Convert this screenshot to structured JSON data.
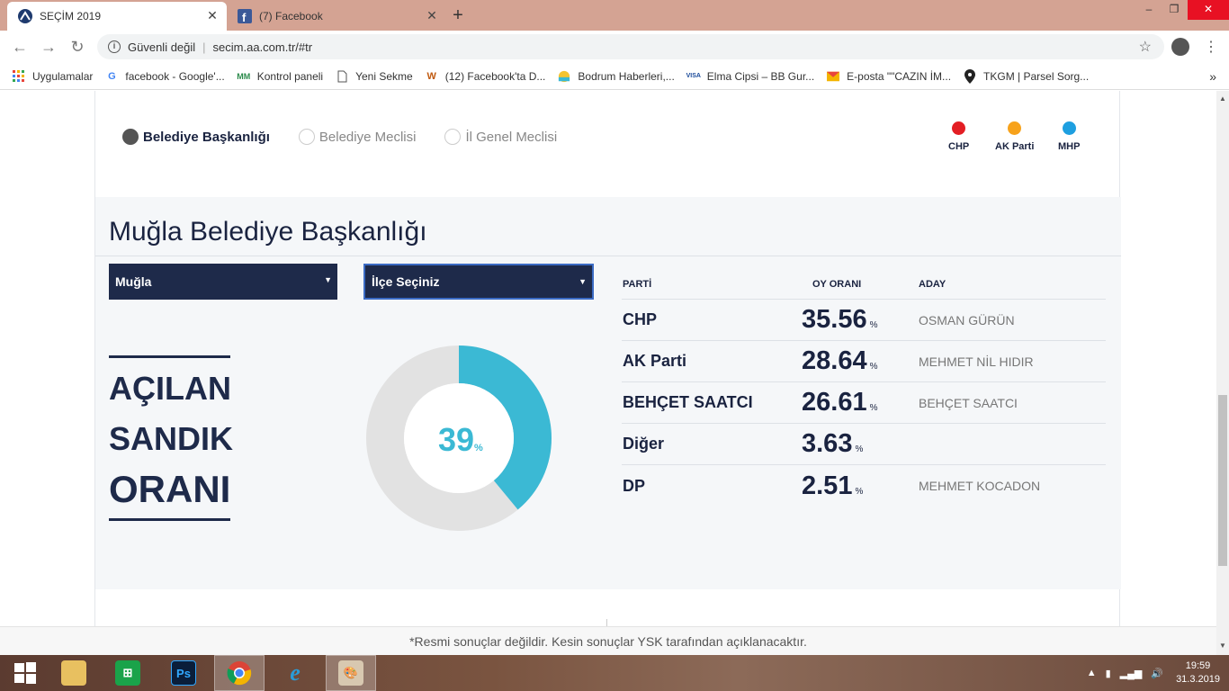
{
  "browser": {
    "tabs": [
      {
        "title": "SEÇİM 2019",
        "icon": "aa-icon"
      },
      {
        "title": "(7) Facebook",
        "icon": "facebook-icon"
      }
    ],
    "new_tab": "+",
    "url_warning": "Güvenli değil",
    "url": "secim.aa.com.tr/#tr",
    "win_min": "–",
    "win_max": "❐",
    "win_close": "✕",
    "back": "←",
    "forward": "→",
    "reload": "↻",
    "info": "i",
    "star": "☆",
    "menu": "⋮",
    "bookmarks": [
      {
        "label": "Uygulamalar",
        "icon": "apps-icon"
      },
      {
        "label": "facebook - Google'...",
        "icon": "google-icon"
      },
      {
        "label": "Kontrol paneli",
        "icon": "panel-icon"
      },
      {
        "label": "Yeni Sekme",
        "icon": "page-icon"
      },
      {
        "label": "(12) Facebook'ta D...",
        "icon": "w-icon"
      },
      {
        "label": "Bodrum Haberleri,...",
        "icon": "bodrum-icon"
      },
      {
        "label": "Elma Cipsi – BB Gur...",
        "icon": "visa-icon"
      },
      {
        "label": "E-posta \"\"CAZIN İM...",
        "icon": "mail-icon"
      },
      {
        "label": "TKGM | Parsel Sorg...",
        "icon": "pin-icon"
      }
    ],
    "bookmarks_more": "»"
  },
  "page": {
    "radios": [
      {
        "label": "Belediye Başkanlığı",
        "selected": true
      },
      {
        "label": "Belediye Meclisi",
        "selected": false
      },
      {
        "label": "İl Genel Meclisi",
        "selected": false
      }
    ],
    "legend": [
      {
        "label": "CHP",
        "color": "#e31e24"
      },
      {
        "label": "AK Parti",
        "color": "#f7a21b"
      },
      {
        "label": "MHP",
        "color": "#1e9fe0"
      }
    ],
    "title": "Muğla Belediye Başkanlığı",
    "select_city": "Muğla",
    "select_district": "İlçe Seçiniz",
    "opened": {
      "line1": "AÇILAN",
      "line2": "SANDIK",
      "line3": "ORANI"
    },
    "opened_pct": "39",
    "opened_pct_value": 39,
    "pct_symbol": "%",
    "table_headers": {
      "party": "PARTİ",
      "rate": "OY ORANI",
      "candidate": "ADAY"
    },
    "results": [
      {
        "party": "CHP",
        "rate": "35.56",
        "candidate": "OSMAN GÜRÜN"
      },
      {
        "party": "AK Parti",
        "rate": "28.64",
        "candidate": "MEHMET NİL HIDIR"
      },
      {
        "party": "BEHÇET SAATCI",
        "rate": "26.61",
        "candidate": "BEHÇET SAATCI"
      },
      {
        "party": "Diğer",
        "rate": "3.63",
        "candidate": ""
      },
      {
        "party": "DP",
        "rate": "2.51",
        "candidate": "MEHMET KOCADON"
      }
    ],
    "footnote": "*Resmi sonuçlar değildir. Kesin sonuçlar YSK tarafından açıklanacaktır."
  },
  "taskbar": {
    "time": "19:59",
    "date": "31.3.2019",
    "apps": [
      "windows-start-icon",
      "file-explorer-icon",
      "store-icon",
      "photoshop-icon",
      "chrome-icon",
      "ie-icon",
      "paint-icon"
    ]
  },
  "colors": {
    "navy": "#1e2a4a",
    "donut_fill": "#3bb9d4",
    "donut_rest": "#e2e2e2"
  }
}
